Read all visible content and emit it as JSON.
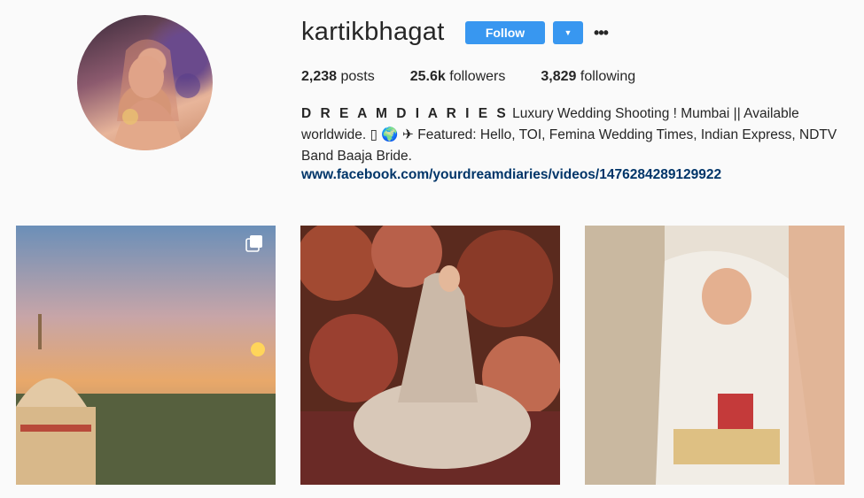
{
  "profile": {
    "username": "kartikbhagat",
    "follow_label": "Follow",
    "dropdown_icon": "caret-down-icon",
    "more_icon": "ellipsis-icon",
    "more_symbol": "•••"
  },
  "stats": {
    "posts_count": "2,238",
    "posts_label": "posts",
    "followers_count": "25.6k",
    "followers_label": "followers",
    "following_count": "3,829",
    "following_label": "following"
  },
  "bio": {
    "name": "D R E A M D I A R I E S",
    "text": " Luxury Wedding Shooting ! Mumbai || Available worldwide. ▯ 🌍 ✈ Featured: Hello, TOI, Femina Wedding Times, Indian Express, NDTV Band Baaja Bride.",
    "link": "www.facebook.com/yourdreamdiaries/videos/1476284289129922"
  },
  "posts": [
    {
      "name": "post-sunset-palace",
      "multi": true
    },
    {
      "name": "post-bride-floral-backdrop",
      "multi": false
    },
    {
      "name": "post-bride-ceremony",
      "multi": false
    }
  ],
  "colors": {
    "accent": "#3897f0",
    "link": "#003569",
    "background": "#fafafa"
  }
}
